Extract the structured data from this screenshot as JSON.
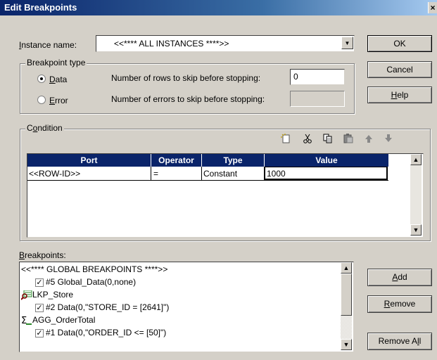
{
  "window": {
    "title": "Edit Breakpoints",
    "close": "×"
  },
  "instance": {
    "label": "Instance name:",
    "value": "<<**** ALL INSTANCES ****>>"
  },
  "buttons": {
    "ok": "OK",
    "cancel": "Cancel",
    "help": "Help",
    "add": "Add",
    "remove": "Remove",
    "remove_all": "Remove All"
  },
  "bp_type": {
    "legend": "Breakpoint type",
    "data_label": "Data",
    "error_label": "Error",
    "data_selected": true,
    "rows_skip_label": "Number of rows to skip before stopping:",
    "rows_skip_value": "0",
    "errors_skip_label": "Number of errors to skip before stopping:",
    "errors_skip_value": ""
  },
  "condition": {
    "legend": "Condition",
    "toolbar_icons": [
      "new-icon",
      "cut-icon",
      "copy-icon",
      "paste-icon",
      "move-up-icon",
      "move-down-icon"
    ],
    "columns": [
      "Port",
      "Operator",
      "Type",
      "Value"
    ],
    "rows": [
      [
        "<<ROW-ID>>",
        "=",
        "Constant",
        "1000"
      ]
    ]
  },
  "breakpoints": {
    "label": "Breakpoints:",
    "items": [
      {
        "text": "<<**** GLOBAL BREAKPOINTS ****>>",
        "level": 0,
        "icon": "",
        "checked": null
      },
      {
        "text": "#5 Global_Data(0,none)",
        "level": 1,
        "icon": "",
        "checked": true
      },
      {
        "text": "LKP_Store",
        "level": 0,
        "icon": "lookup-transformation-icon",
        "checked": null
      },
      {
        "text": "#2 Data(0,\"STORE_ID = [2641]\")",
        "level": 1,
        "icon": "",
        "checked": true
      },
      {
        "text": "AGG_OrderTotal",
        "level": 0,
        "icon": "aggregator-transformation-icon",
        "checked": null
      },
      {
        "text": "#1 Data(0,\"ORDER_ID <= [50]\")",
        "level": 1,
        "icon": "",
        "checked": true
      }
    ]
  },
  "colors": {
    "title_start": "#0a246a",
    "title_end": "#a6caf0",
    "header_bg": "#0a246a",
    "dialog_bg": "#d4d0c8"
  }
}
